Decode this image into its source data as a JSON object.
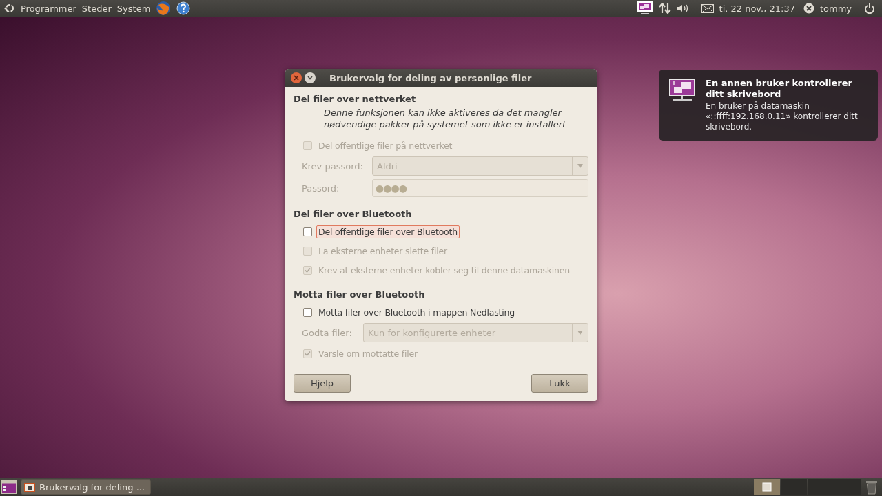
{
  "top_panel": {
    "menus": [
      "Programmer",
      "Steder",
      "System"
    ],
    "clock": "ti. 22 nov., 21:37",
    "user": "tommy"
  },
  "dialog": {
    "title": "Brukervalg for deling av personlige filer",
    "sections": [
      {
        "title": "Del filer over nettverket",
        "rows": [
          {
            "kind": "note",
            "text": "Denne funksjonen kan ikke aktiveres da det mangler nødvendige pakker på systemet som ikke er installert"
          },
          {
            "kind": "checkbox",
            "label": "Del offentlige filer på nettverket",
            "checked": false,
            "disabled": true,
            "focused": false
          },
          {
            "kind": "combo",
            "label": "Krev passord:",
            "value": "Aldri",
            "disabled": true
          },
          {
            "kind": "password",
            "label": "Passord:",
            "value": "●●●●",
            "disabled": true
          }
        ]
      },
      {
        "title": "Del filer over Bluetooth",
        "rows": [
          {
            "kind": "checkbox",
            "label": "Del offentlige filer over Bluetooth",
            "checked": false,
            "disabled": false,
            "focused": true
          },
          {
            "kind": "checkbox",
            "label": "La eksterne enheter slette filer",
            "checked": false,
            "disabled": true,
            "focused": false
          },
          {
            "kind": "checkbox",
            "label": "Krev at eksterne enheter kobler seg til denne datamaskinen",
            "checked": true,
            "disabled": true,
            "focused": false
          }
        ]
      },
      {
        "title": "Motta filer over Bluetooth",
        "rows": [
          {
            "kind": "checkbox",
            "label": "Motta filer over Bluetooth i mappen Nedlasting",
            "checked": false,
            "disabled": false,
            "focused": false
          },
          {
            "kind": "combo",
            "label": "Godta filer:",
            "value": "Kun for konfigurerte enheter",
            "disabled": true
          },
          {
            "kind": "checkbox",
            "label": "Varsle om mottatte filer",
            "checked": true,
            "disabled": true,
            "focused": false
          }
        ]
      }
    ],
    "buttons": [
      "Hjelp",
      "Lukk"
    ]
  },
  "notification": {
    "title": "En annen bruker kontrollerer ditt skrivebord",
    "body": "En bruker på datamaskin «::ffff:192.168.0.11» kontrollerer ditt skrivebord."
  },
  "bottom_panel": {
    "task": "Brukervalg for deling ...",
    "workspaces": [
      {
        "selected": true
      },
      {
        "selected": false
      },
      {
        "selected": false
      },
      {
        "selected": false
      }
    ]
  }
}
